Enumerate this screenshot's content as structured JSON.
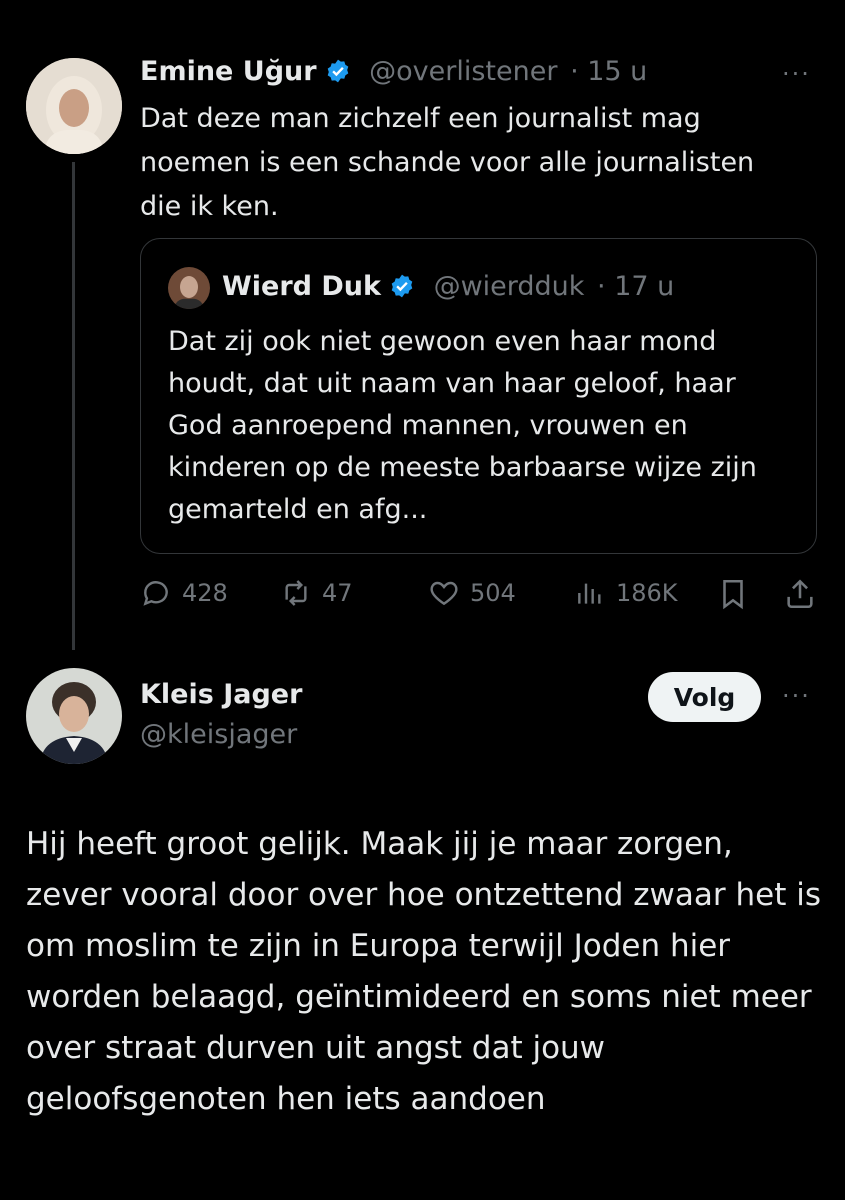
{
  "reply_post": {
    "author_name": "Emine Uğur",
    "author_handle": "@overlistener",
    "time": "· 15 u",
    "text": "Dat deze man zichzelf een journalist mag noemen is een schande voor alle journalisten die ik ken.",
    "more_label": "···",
    "quoted": {
      "author_name": "Wierd Duk",
      "author_handle": "@wierdduk",
      "time": "· 17 u",
      "text": "Dat zij ook niet gewoon even haar mond houdt, dat uit naam van haar geloof, haar God aanroepend mannen, vrouwen en kinderen op de meeste barbaarse wijze zijn gemarteld en afg..."
    },
    "actions": {
      "replies": "428",
      "reposts": "47",
      "likes": "504",
      "views": "186K"
    }
  },
  "main_post": {
    "author_name": "Kleis Jager",
    "author_handle": "@kleisjager",
    "follow_label": "Volg",
    "more_label": "···",
    "text": "Hij heeft groot gelijk. Maak jij je maar zorgen, zever vooral door over hoe ontzettend zwaar het is om moslim te zijn in Europa terwijl Joden hier worden belaagd, geïntimideerd en soms niet meer over straat durven uit angst dat jouw geloofsgenoten hen iets aandoen"
  },
  "colors": {
    "background": "#000000",
    "text": "#e7e9ea",
    "muted": "#71767b",
    "verified": "#1d9bf0",
    "thread_line": "#333639"
  },
  "icons": [
    "verified-badge-icon",
    "reply-icon",
    "repost-icon",
    "like-icon",
    "views-icon",
    "bookmark-icon",
    "share-icon",
    "more-icon"
  ]
}
